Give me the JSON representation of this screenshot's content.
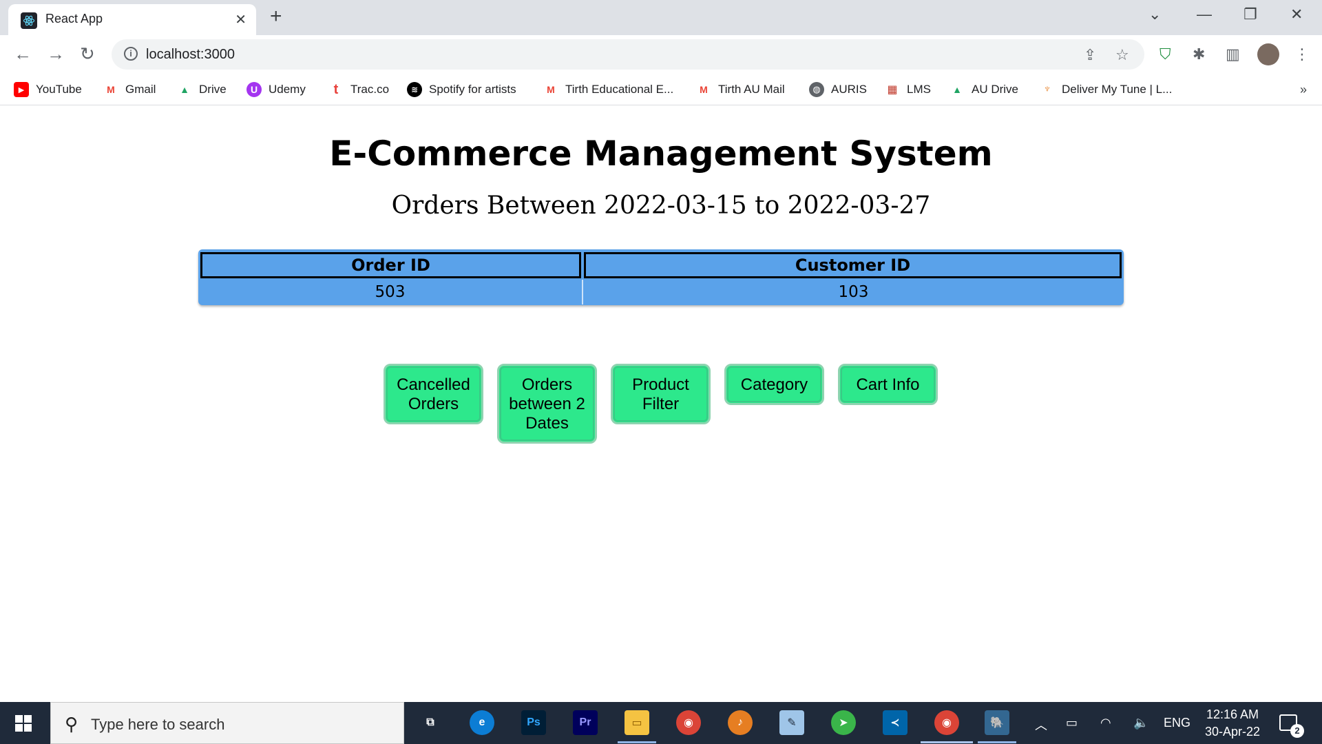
{
  "browser": {
    "tab_title": "React App",
    "url": "localhost:3000",
    "bookmarks": [
      {
        "label": "YouTube",
        "icon": "youtube-icon",
        "color": "#ff0000"
      },
      {
        "label": "Gmail",
        "icon": "gmail-icon",
        "color": "#ea4335"
      },
      {
        "label": "Drive",
        "icon": "drive-icon",
        "color": "#1fa463"
      },
      {
        "label": "Udemy",
        "icon": "udemy-icon",
        "color": "#a435f0"
      },
      {
        "label": "Trac.co",
        "icon": "trac-icon",
        "color": "#e8413b"
      },
      {
        "label": "Spotify for artists",
        "icon": "spotify-icon",
        "color": "#000000"
      },
      {
        "label": "Tirth Educational E...",
        "icon": "gmail-icon",
        "color": "#ea4335"
      },
      {
        "label": "Tirth AU Mail",
        "icon": "gmail-icon",
        "color": "#ea4335"
      },
      {
        "label": "AURIS",
        "icon": "globe-icon",
        "color": "#5f6368"
      },
      {
        "label": "LMS",
        "icon": "lms-icon",
        "color": "#c0392b"
      },
      {
        "label": "AU Drive",
        "icon": "drive-icon",
        "color": "#1fa463"
      },
      {
        "label": "Deliver My Tune | L...",
        "icon": "deliver-my-tune-icon",
        "color": "#e67e22"
      }
    ],
    "more_bookmarks": "»"
  },
  "page": {
    "title": "E-Commerce Management System",
    "subtitle": "Orders Between 2022-03-15 to 2022-03-27",
    "table": {
      "headers": [
        "Order ID",
        "Customer ID"
      ],
      "rows": [
        [
          "503",
          "103"
        ]
      ]
    },
    "buttons": [
      "Cancelled Orders",
      "Orders between 2 Dates",
      "Product Filter",
      "Category",
      "Cart Info"
    ],
    "colors": {
      "table_bg": "#5aa2ea",
      "button_bg": "#2de88c"
    }
  },
  "taskbar": {
    "search_placeholder": "Type here to search",
    "language": "ENG",
    "time": "12:16 AM",
    "date": "30-Apr-22",
    "notification_count": "2"
  }
}
